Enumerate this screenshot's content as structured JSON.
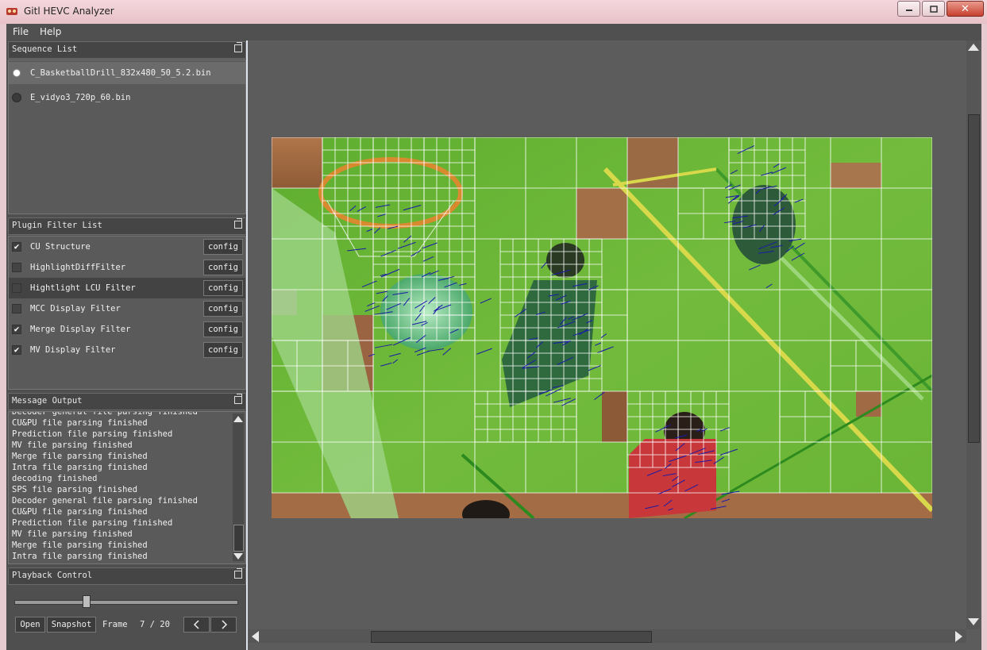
{
  "window": {
    "title": "Gitl HEVC Analyzer",
    "app_icon": "analyzer-logo-icon"
  },
  "menu": {
    "items": [
      "File",
      "Help"
    ]
  },
  "sequence_list": {
    "title": "Sequence List",
    "items": [
      {
        "label": "C_BasketballDrill_832x480_50_5.2.bin",
        "selected": true
      },
      {
        "label": "E_vidyo3_720p_60.bin",
        "selected": false
      }
    ]
  },
  "plugin_filter_list": {
    "title": "Plugin Filter List",
    "config_label": "config",
    "filters": [
      {
        "label": "CU Structure",
        "checked": true
      },
      {
        "label": "HighlightDiffFilter",
        "checked": false
      },
      {
        "label": "Hightlight LCU Filter",
        "checked": false
      },
      {
        "label": "MCC Display Filter",
        "checked": false
      },
      {
        "label": "Merge Display Filter",
        "checked": true
      },
      {
        "label": "MV Display Filter",
        "checked": true
      }
    ]
  },
  "message_output": {
    "title": "Message Output",
    "lines": [
      "Decoder general file parsing finished",
      "CU&PU file parsing finished",
      "Prediction file parsing finished",
      "MV file parsing finished",
      "Merge file parsing finished",
      "Intra file parsing finished",
      "decoding finished",
      "SPS file parsing finished",
      "Decoder general file parsing finished",
      "CU&PU file parsing finished",
      "Prediction file parsing finished",
      "MV file parsing finished",
      "Merge file parsing finished",
      "Intra file parsing finished"
    ]
  },
  "playback_control": {
    "title": "Playback Control",
    "open_label": "Open",
    "snapshot_label": "Snapshot",
    "frame_label": "Frame",
    "frame_counter": "7 / 20",
    "prev_icon": "chevron-left-icon",
    "next_icon": "chevron-right-icon",
    "slider_fraction": 0.32
  },
  "colors": {
    "court_green": "#6cb83a",
    "grid_line": "#ffffff",
    "motion_vector": "#1a1aa8",
    "dark_panel": "#4f4f4f"
  }
}
